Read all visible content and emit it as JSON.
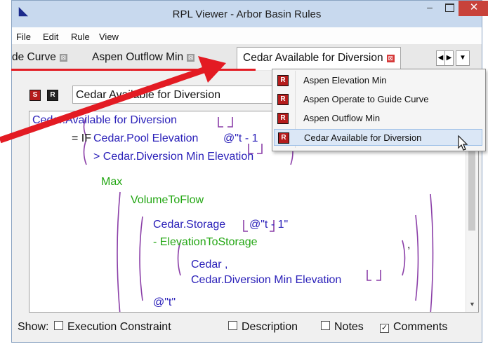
{
  "window": {
    "title": "RPL Viewer - Arbor Basin Rules",
    "controls": {
      "minimize": "–",
      "close": "✕"
    }
  },
  "menu": [
    "File",
    "Edit",
    "Rule",
    "View"
  ],
  "tabs": [
    {
      "label": "de Curve",
      "close": "⊠"
    },
    {
      "label": "Aspen Outflow Min",
      "close": "⊠"
    },
    {
      "label": "Cedar Available for Diversion",
      "close": "⊠",
      "active": true
    }
  ],
  "tab_nav": {
    "left": "◀",
    "right": "▶",
    "menu": "▼"
  },
  "editor_header": {
    "icon_s": "S",
    "icon_r": "R",
    "rule_name": "Cedar Available for Diversion"
  },
  "code": {
    "l1_name": "Cedar.Available for Diversion",
    "l1_brackets": "[]",
    "l2_eq_if": "= IF",
    "l2_expr": "Cedar.Pool Elevation",
    "l2_arg": "@\"t - 1",
    "l3_expr": "> Cedar.Diversion Min Elevation",
    "l3_brackets": "[]",
    "l4_max": "Max",
    "l5_fn": "VolumeToFlow",
    "l6_expr": "Cedar.Storage",
    "l6_arg": "@\"t - 1\"",
    "l7_fn": "- ElevationToStorage",
    "l7_comma": ",",
    "l8_obj": "Cedar ,",
    "l9_expr": "Cedar.Diversion Min Elevation",
    "l9_brackets": "[]",
    "l10_arg": "@\"t\""
  },
  "dropdown": {
    "items": [
      {
        "icon": "R",
        "label": "Aspen Elevation Min"
      },
      {
        "icon": "R",
        "label": "Aspen Operate to Guide Curve"
      },
      {
        "icon": "R",
        "label": "Aspen Outflow Min"
      },
      {
        "icon": "R",
        "label": "Cedar Available for Diversion",
        "highlighted": true
      }
    ]
  },
  "show_bar": {
    "label": "Show:",
    "options": [
      {
        "label": "Execution Constraint",
        "checked": false
      },
      {
        "label": "Description",
        "checked": false
      },
      {
        "label": "Notes",
        "checked": false
      },
      {
        "label": "Comments",
        "checked": true
      }
    ]
  },
  "colors": {
    "accent_red": "#e31b23",
    "code_blue": "#2b21b9",
    "code_green": "#22a612",
    "bracket_purple": "#8b3fa8",
    "titlebar": "#c8d9ee"
  }
}
